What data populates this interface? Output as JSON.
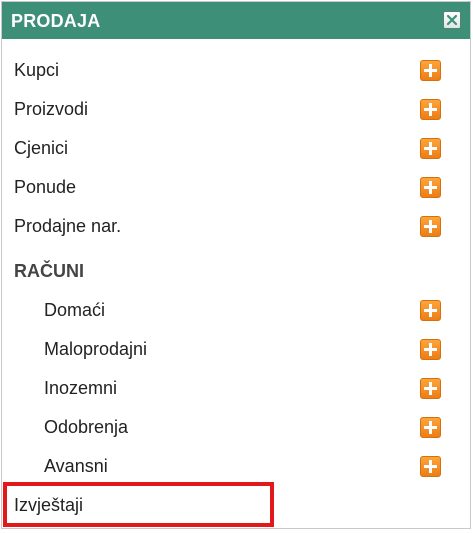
{
  "panel": {
    "title": "PRODAJA",
    "close_icon": "close-icon"
  },
  "menu": {
    "items": [
      {
        "label": "Kupci",
        "icon": "add-icon"
      },
      {
        "label": "Proizvodi",
        "icon": "add-icon"
      },
      {
        "label": "Cjenici",
        "icon": "add-icon"
      },
      {
        "label": "Ponude",
        "icon": "add-icon"
      },
      {
        "label": "Prodajne nar.",
        "icon": "add-icon"
      }
    ],
    "section": {
      "title": "RAČUNI",
      "items": [
        {
          "label": "Domaći",
          "icon": "add-icon"
        },
        {
          "label": "Maloprodajni",
          "icon": "add-icon"
        },
        {
          "label": "Inozemni",
          "icon": "add-icon"
        },
        {
          "label": "Odobrenja",
          "icon": "add-icon"
        },
        {
          "label": "Avansni",
          "icon": "add-icon"
        }
      ]
    },
    "reports": {
      "label": "Izvještaji"
    }
  },
  "colors": {
    "header": "#3d8f78",
    "add_button": "#f58a1f",
    "highlight": "#e2191b"
  }
}
